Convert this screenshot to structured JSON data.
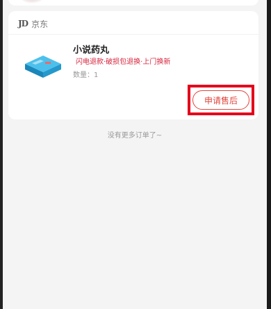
{
  "shop": {
    "logo_text": "JD",
    "name": "京东"
  },
  "order": {
    "product_title": "小说药丸",
    "product_tags": "闪电退款·破损包退换·上门换新",
    "quantity_text": "数量：1",
    "action_label": "申请售后"
  },
  "footer": {
    "end_text": "没有更多订单了~"
  },
  "colors": {
    "accent": "#e2453c",
    "tag_red": "#d7263d",
    "highlight": "#e3001b",
    "background": "#f4f4f4",
    "product_blue": "#2ba3d8"
  }
}
